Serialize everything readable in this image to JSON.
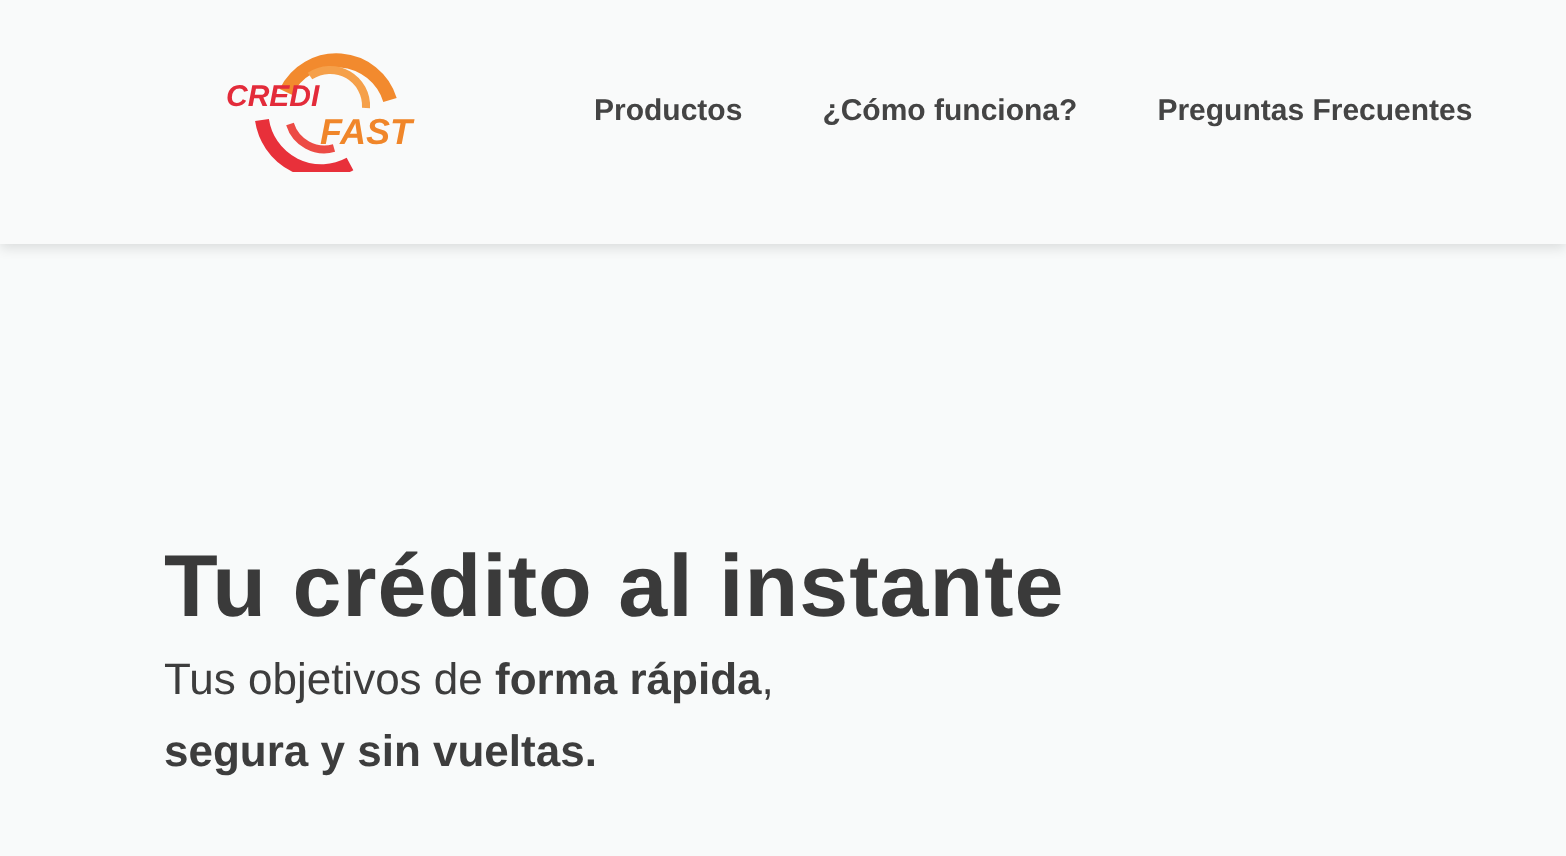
{
  "logo": {
    "word_1": "CREDI",
    "word_2": "FAST"
  },
  "nav": [
    {
      "label": "Productos"
    },
    {
      "label": "¿Cómo funciona?"
    },
    {
      "label": "Preguntas Frecuentes"
    }
  ],
  "hero": {
    "title": "Tu crédito al instante",
    "subtitle_line_1": "Tus objetivos de **forma rápida**,",
    "subtitle_line_2": "segura y sin vueltas."
  }
}
